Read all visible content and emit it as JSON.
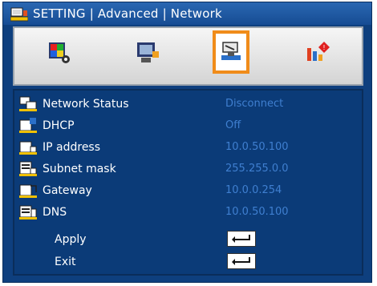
{
  "window": {
    "title": "SETTING | Advanced | Network",
    "icon": "settings-menu-icon"
  },
  "tabs": [
    {
      "icon": "image-palette-icon",
      "selected": false
    },
    {
      "icon": "screen-display-icon",
      "selected": false
    },
    {
      "icon": "setting-hand-icon",
      "selected": true
    },
    {
      "icon": "info-options-icon",
      "selected": false
    }
  ],
  "network": {
    "rows": [
      {
        "label": "Network Status",
        "value": "Disconnect",
        "icon": "network-status-icon"
      },
      {
        "label": "DHCP",
        "value": "Off",
        "icon": "dhcp-icon"
      },
      {
        "label": "IP address",
        "value": "10.0.50.100",
        "icon": "ip-address-icon"
      },
      {
        "label": "Subnet mask",
        "value": "255.255.0.0",
        "icon": "subnet-mask-icon"
      },
      {
        "label": "Gateway",
        "value": "10.0.0.254",
        "icon": "gateway-icon"
      },
      {
        "label": "DNS",
        "value": "10.0.50.100",
        "icon": "dns-icon"
      }
    ],
    "apply_label": "Apply",
    "exit_label": "Exit"
  },
  "colors": {
    "frame": "#0e3f7e",
    "titlebar": "#1d57a0",
    "panel": "#0b3b78",
    "value_text": "#3f7fd0",
    "selected_tab_border": "#f08c1a"
  }
}
